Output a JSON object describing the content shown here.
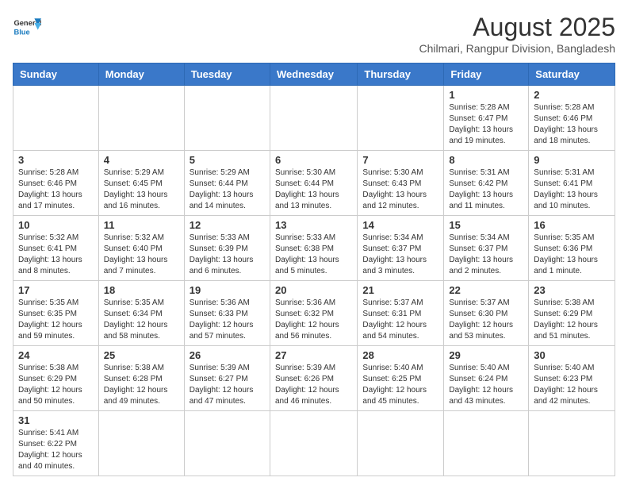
{
  "logo": {
    "general": "General",
    "blue": "Blue"
  },
  "header": {
    "month_year": "August 2025",
    "location": "Chilmari, Rangpur Division, Bangladesh"
  },
  "days_of_week": [
    "Sunday",
    "Monday",
    "Tuesday",
    "Wednesday",
    "Thursday",
    "Friday",
    "Saturday"
  ],
  "weeks": [
    [
      {
        "day": "",
        "info": ""
      },
      {
        "day": "",
        "info": ""
      },
      {
        "day": "",
        "info": ""
      },
      {
        "day": "",
        "info": ""
      },
      {
        "day": "",
        "info": ""
      },
      {
        "day": "1",
        "info": "Sunrise: 5:28 AM\nSunset: 6:47 PM\nDaylight: 13 hours and 19 minutes."
      },
      {
        "day": "2",
        "info": "Sunrise: 5:28 AM\nSunset: 6:46 PM\nDaylight: 13 hours and 18 minutes."
      }
    ],
    [
      {
        "day": "3",
        "info": "Sunrise: 5:28 AM\nSunset: 6:46 PM\nDaylight: 13 hours and 17 minutes."
      },
      {
        "day": "4",
        "info": "Sunrise: 5:29 AM\nSunset: 6:45 PM\nDaylight: 13 hours and 16 minutes."
      },
      {
        "day": "5",
        "info": "Sunrise: 5:29 AM\nSunset: 6:44 PM\nDaylight: 13 hours and 14 minutes."
      },
      {
        "day": "6",
        "info": "Sunrise: 5:30 AM\nSunset: 6:44 PM\nDaylight: 13 hours and 13 minutes."
      },
      {
        "day": "7",
        "info": "Sunrise: 5:30 AM\nSunset: 6:43 PM\nDaylight: 13 hours and 12 minutes."
      },
      {
        "day": "8",
        "info": "Sunrise: 5:31 AM\nSunset: 6:42 PM\nDaylight: 13 hours and 11 minutes."
      },
      {
        "day": "9",
        "info": "Sunrise: 5:31 AM\nSunset: 6:41 PM\nDaylight: 13 hours and 10 minutes."
      }
    ],
    [
      {
        "day": "10",
        "info": "Sunrise: 5:32 AM\nSunset: 6:41 PM\nDaylight: 13 hours and 8 minutes."
      },
      {
        "day": "11",
        "info": "Sunrise: 5:32 AM\nSunset: 6:40 PM\nDaylight: 13 hours and 7 minutes."
      },
      {
        "day": "12",
        "info": "Sunrise: 5:33 AM\nSunset: 6:39 PM\nDaylight: 13 hours and 6 minutes."
      },
      {
        "day": "13",
        "info": "Sunrise: 5:33 AM\nSunset: 6:38 PM\nDaylight: 13 hours and 5 minutes."
      },
      {
        "day": "14",
        "info": "Sunrise: 5:34 AM\nSunset: 6:37 PM\nDaylight: 13 hours and 3 minutes."
      },
      {
        "day": "15",
        "info": "Sunrise: 5:34 AM\nSunset: 6:37 PM\nDaylight: 13 hours and 2 minutes."
      },
      {
        "day": "16",
        "info": "Sunrise: 5:35 AM\nSunset: 6:36 PM\nDaylight: 13 hours and 1 minute."
      }
    ],
    [
      {
        "day": "17",
        "info": "Sunrise: 5:35 AM\nSunset: 6:35 PM\nDaylight: 12 hours and 59 minutes."
      },
      {
        "day": "18",
        "info": "Sunrise: 5:35 AM\nSunset: 6:34 PM\nDaylight: 12 hours and 58 minutes."
      },
      {
        "day": "19",
        "info": "Sunrise: 5:36 AM\nSunset: 6:33 PM\nDaylight: 12 hours and 57 minutes."
      },
      {
        "day": "20",
        "info": "Sunrise: 5:36 AM\nSunset: 6:32 PM\nDaylight: 12 hours and 56 minutes."
      },
      {
        "day": "21",
        "info": "Sunrise: 5:37 AM\nSunset: 6:31 PM\nDaylight: 12 hours and 54 minutes."
      },
      {
        "day": "22",
        "info": "Sunrise: 5:37 AM\nSunset: 6:30 PM\nDaylight: 12 hours and 53 minutes."
      },
      {
        "day": "23",
        "info": "Sunrise: 5:38 AM\nSunset: 6:29 PM\nDaylight: 12 hours and 51 minutes."
      }
    ],
    [
      {
        "day": "24",
        "info": "Sunrise: 5:38 AM\nSunset: 6:29 PM\nDaylight: 12 hours and 50 minutes."
      },
      {
        "day": "25",
        "info": "Sunrise: 5:38 AM\nSunset: 6:28 PM\nDaylight: 12 hours and 49 minutes."
      },
      {
        "day": "26",
        "info": "Sunrise: 5:39 AM\nSunset: 6:27 PM\nDaylight: 12 hours and 47 minutes."
      },
      {
        "day": "27",
        "info": "Sunrise: 5:39 AM\nSunset: 6:26 PM\nDaylight: 12 hours and 46 minutes."
      },
      {
        "day": "28",
        "info": "Sunrise: 5:40 AM\nSunset: 6:25 PM\nDaylight: 12 hours and 45 minutes."
      },
      {
        "day": "29",
        "info": "Sunrise: 5:40 AM\nSunset: 6:24 PM\nDaylight: 12 hours and 43 minutes."
      },
      {
        "day": "30",
        "info": "Sunrise: 5:40 AM\nSunset: 6:23 PM\nDaylight: 12 hours and 42 minutes."
      }
    ],
    [
      {
        "day": "31",
        "info": "Sunrise: 5:41 AM\nSunset: 6:22 PM\nDaylight: 12 hours and 40 minutes."
      },
      {
        "day": "",
        "info": ""
      },
      {
        "day": "",
        "info": ""
      },
      {
        "day": "",
        "info": ""
      },
      {
        "day": "",
        "info": ""
      },
      {
        "day": "",
        "info": ""
      },
      {
        "day": "",
        "info": ""
      }
    ]
  ]
}
